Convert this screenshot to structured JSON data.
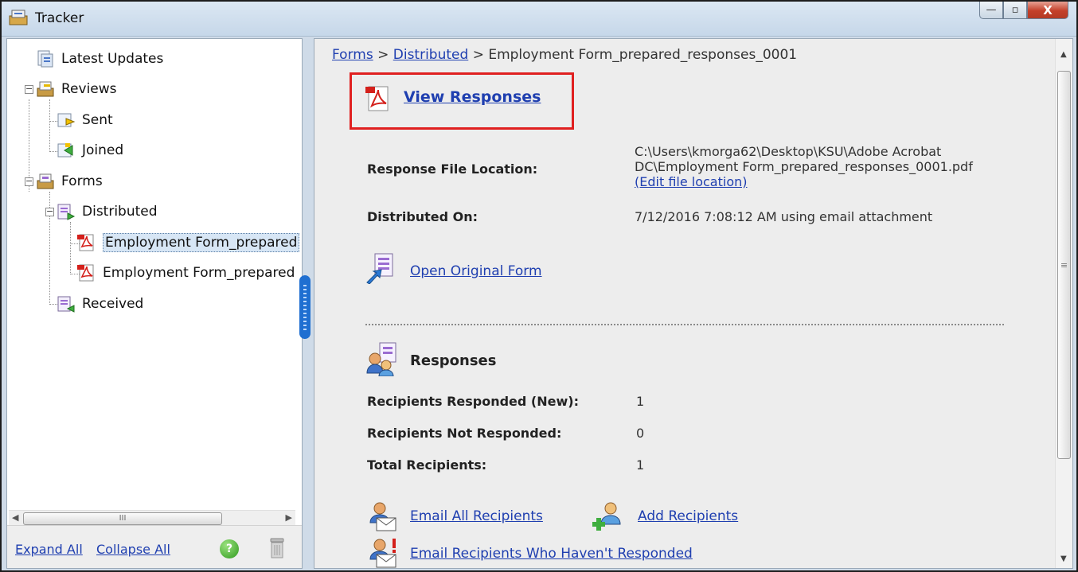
{
  "window": {
    "title": "Tracker",
    "buttons": {
      "minimize": "—",
      "maximize": "▫",
      "close": "X"
    }
  },
  "tree": {
    "items": [
      {
        "label": "Latest Updates",
        "icon": "latest-updates-icon"
      },
      {
        "label": "Reviews",
        "icon": "reviews-icon",
        "expander": "−"
      },
      {
        "label": "Sent",
        "icon": "sent-icon"
      },
      {
        "label": "Joined",
        "icon": "joined-icon"
      },
      {
        "label": "Forms",
        "icon": "forms-icon",
        "expander": "−"
      },
      {
        "label": "Distributed",
        "icon": "distributed-icon",
        "expander": "−"
      },
      {
        "label": "Employment Form_prepared",
        "icon": "pdf-icon",
        "selected": true
      },
      {
        "label": "Employment Form_prepared",
        "icon": "pdf-icon"
      },
      {
        "label": "Received",
        "icon": "received-icon"
      }
    ],
    "hscroll_grip": "III"
  },
  "footer": {
    "expand_all": "Expand All",
    "collapse_all": "Collapse All",
    "help": "?"
  },
  "main": {
    "breadcrumb": {
      "forms": "Forms",
      "sep": ">",
      "distributed": "Distributed",
      "current": "Employment Form_prepared_responses_0001"
    },
    "view_responses": "View Responses",
    "response_file_location_label": "Response File Location:",
    "response_file_location_line1": "C:\\Users\\kmorga62\\Desktop\\KSU\\Adobe Acrobat",
    "response_file_location_line2": "DC\\Employment Form_prepared_responses_0001.pdf",
    "edit_file_location": "(Edit file location)",
    "distributed_on_label": "Distributed On:",
    "distributed_on_value": "7/12/2016 7:08:12 AM using email attachment",
    "open_original_form": "Open Original Form",
    "responses_title": "Responses",
    "stats": [
      {
        "label": "Recipients Responded (New):",
        "value": "1"
      },
      {
        "label": "Recipients Not Responded:",
        "value": "0"
      },
      {
        "label": "Total Recipients:",
        "value": "1"
      }
    ],
    "email_all": "Email All Recipients",
    "add_recipients": "Add Recipients",
    "email_not_responded": "Email Recipients Who Haven't Responded"
  },
  "colors": {
    "link": "#1f3fb0",
    "highlight_box": "#e02020",
    "selection": "#d7e6f5"
  }
}
